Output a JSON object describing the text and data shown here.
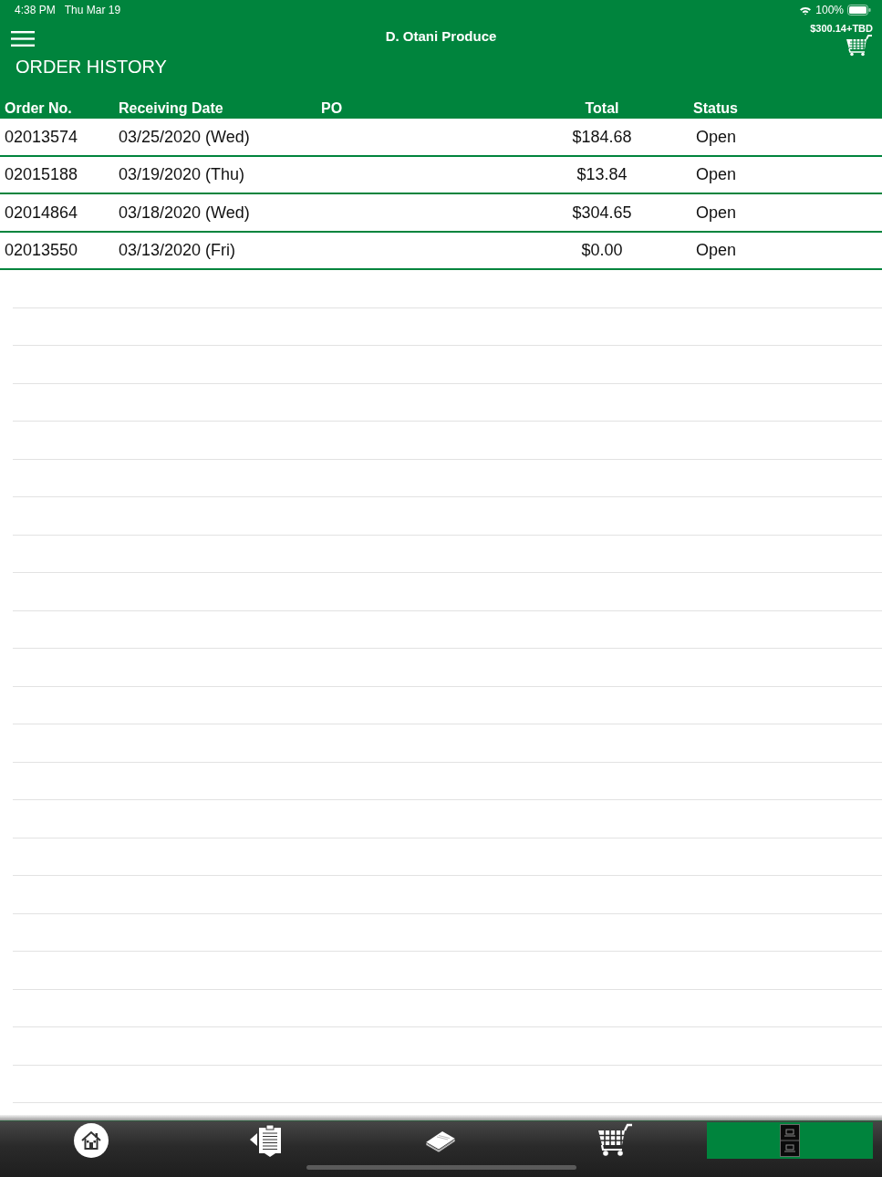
{
  "status_bar": {
    "time": "4:38 PM",
    "date": "Thu Mar 19",
    "battery": "100%"
  },
  "header": {
    "title": "D. Otani Produce",
    "cart_total": "$300.14+TBD",
    "page_title": "ORDER HISTORY"
  },
  "table": {
    "columns": [
      "Order No.",
      "Receiving Date",
      "PO",
      "Total",
      "Status"
    ],
    "rows": [
      {
        "order_no": "02013574",
        "receiving_date": "03/25/2020 (Wed)",
        "total": "$184.68",
        "status": "Open"
      },
      {
        "order_no": "02015188",
        "receiving_date": "03/19/2020 (Thu)",
        "total": "$13.84",
        "status": "Open"
      },
      {
        "order_no": "02014864",
        "receiving_date": "03/18/2020 (Wed)",
        "total": "$304.65",
        "status": "Open"
      },
      {
        "order_no": "02013550",
        "receiving_date": "03/13/2020 (Fri)",
        "total": "$0.00",
        "status": "Open"
      }
    ]
  },
  "tab_bar": {
    "tabs": [
      {
        "kind": "home",
        "selected": false
      },
      {
        "kind": "orders",
        "selected": false
      },
      {
        "kind": "catalog",
        "selected": false
      },
      {
        "kind": "cart",
        "selected": false
      },
      {
        "kind": "history",
        "selected": true
      }
    ]
  }
}
